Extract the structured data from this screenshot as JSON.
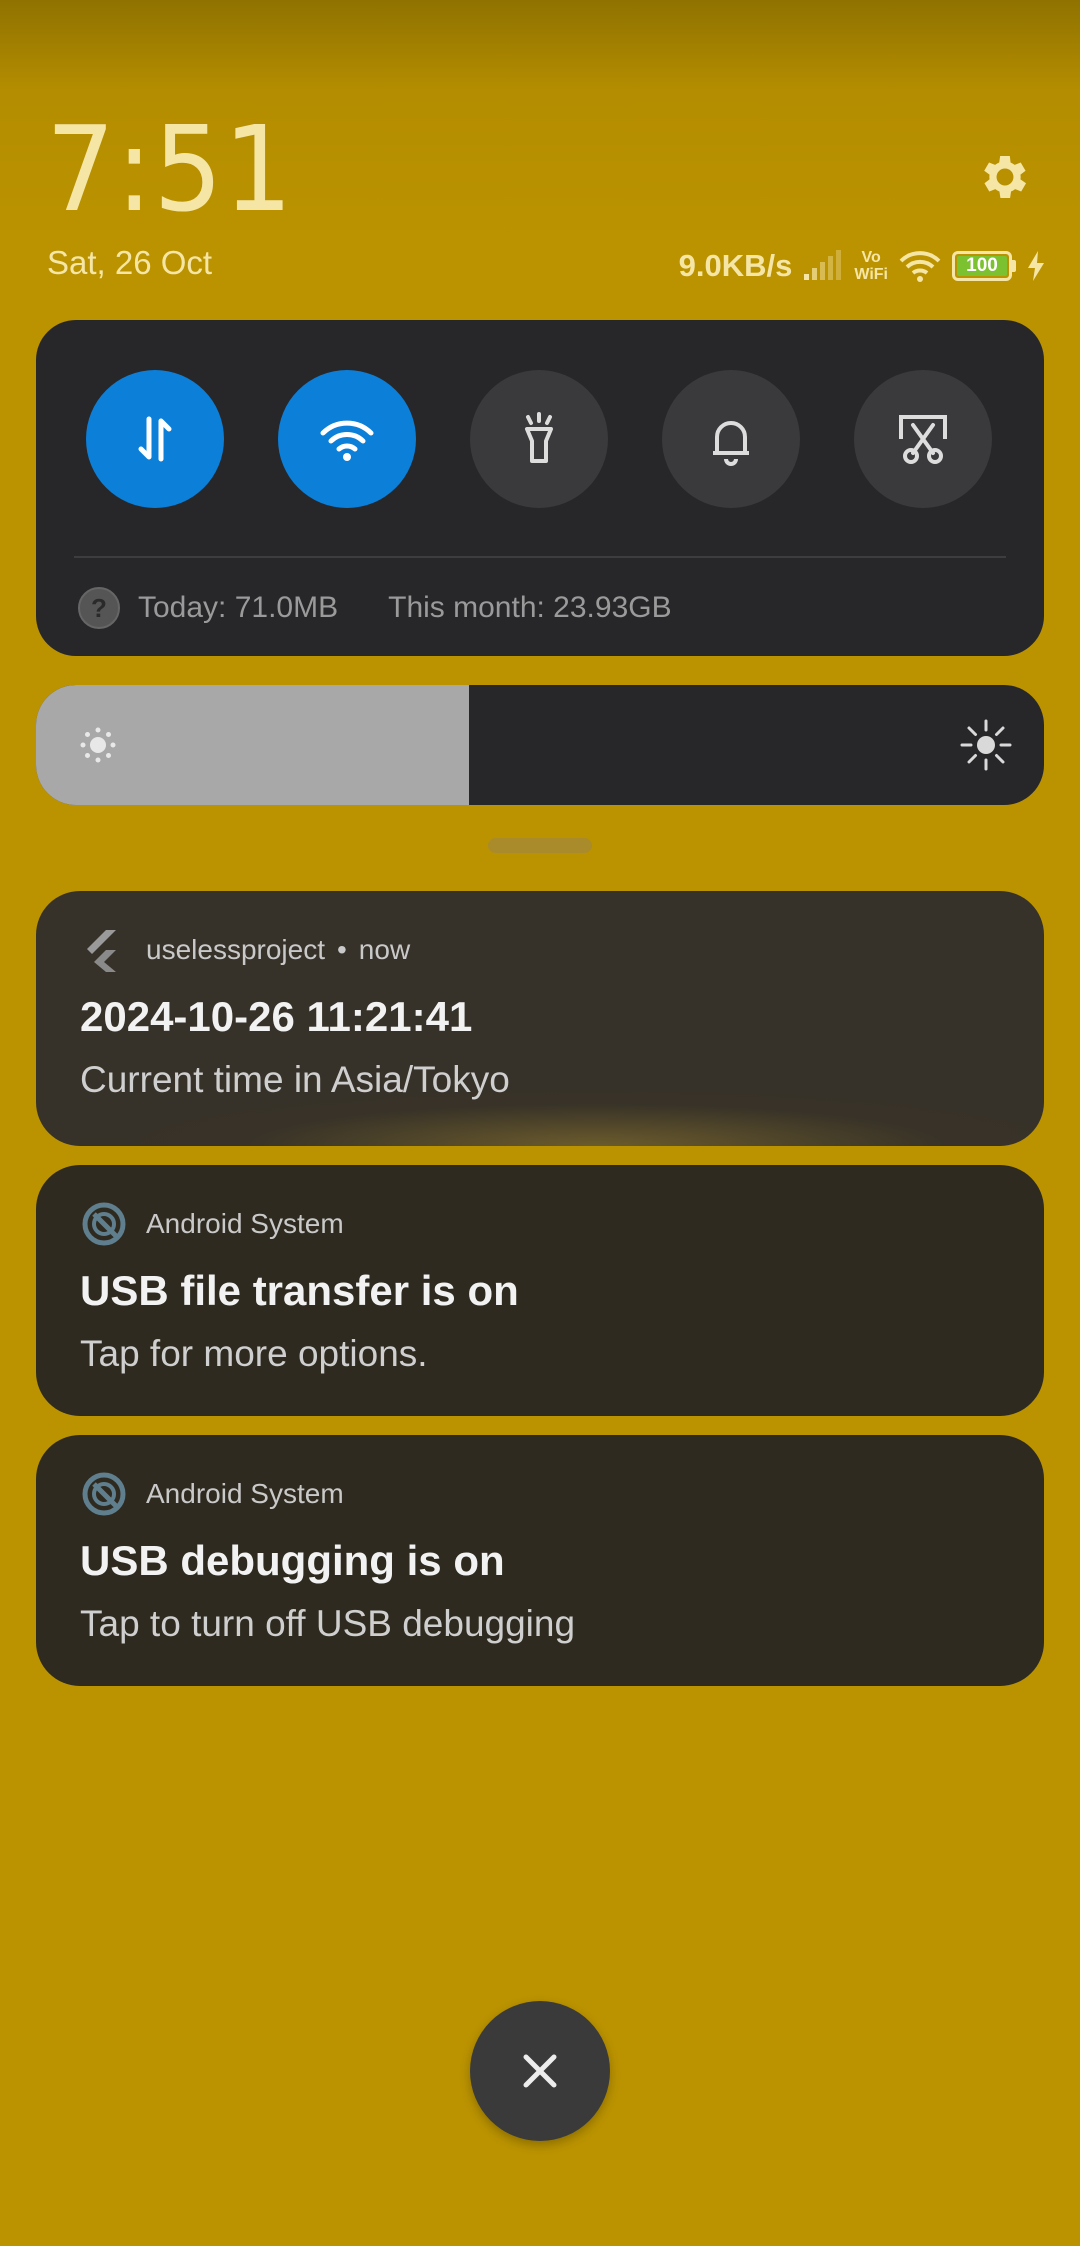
{
  "header": {
    "time": "7:51",
    "date": "Sat, 26 Oct",
    "net_speed": "9.0KB/s",
    "vowifi_top": "Vo",
    "vowifi_bottom": "WiFi",
    "battery_level": "100",
    "icons": [
      "gear-icon",
      "signal-icon",
      "wifi-icon",
      "battery-icon",
      "charging-icon"
    ]
  },
  "quick_settings": {
    "tiles": [
      {
        "name": "mobile-data",
        "icon": "data-transfer-icon",
        "active": true
      },
      {
        "name": "wifi",
        "icon": "wifi-icon",
        "active": true
      },
      {
        "name": "flashlight",
        "icon": "flashlight-icon",
        "active": false
      },
      {
        "name": "sound",
        "icon": "bell-icon",
        "active": false
      },
      {
        "name": "screenshot",
        "icon": "screenshot-icon",
        "active": false
      }
    ],
    "data_usage": {
      "today": "Today: 71.0MB",
      "month": "This month: 23.93GB"
    }
  },
  "brightness": {
    "level": 0.43
  },
  "notifications": [
    {
      "app": "uselessproject",
      "time": "now",
      "separator": "•",
      "title": "2024-10-26 11:21:41",
      "body": "Current time in Asia/Tokyo",
      "icon": "flutter-icon"
    },
    {
      "app": "Android System",
      "title": "USB file transfer is on",
      "body": "Tap for more options.",
      "icon": "android-system-icon"
    },
    {
      "app": "Android System",
      "title": "USB debugging is on",
      "body": "Tap to turn off USB debugging",
      "icon": "android-system-icon"
    }
  ],
  "colors": {
    "wallpaper": "#bb9300",
    "panel": "#27272a",
    "accent": "#0c7fd8",
    "notification": "#2e2a1f"
  }
}
